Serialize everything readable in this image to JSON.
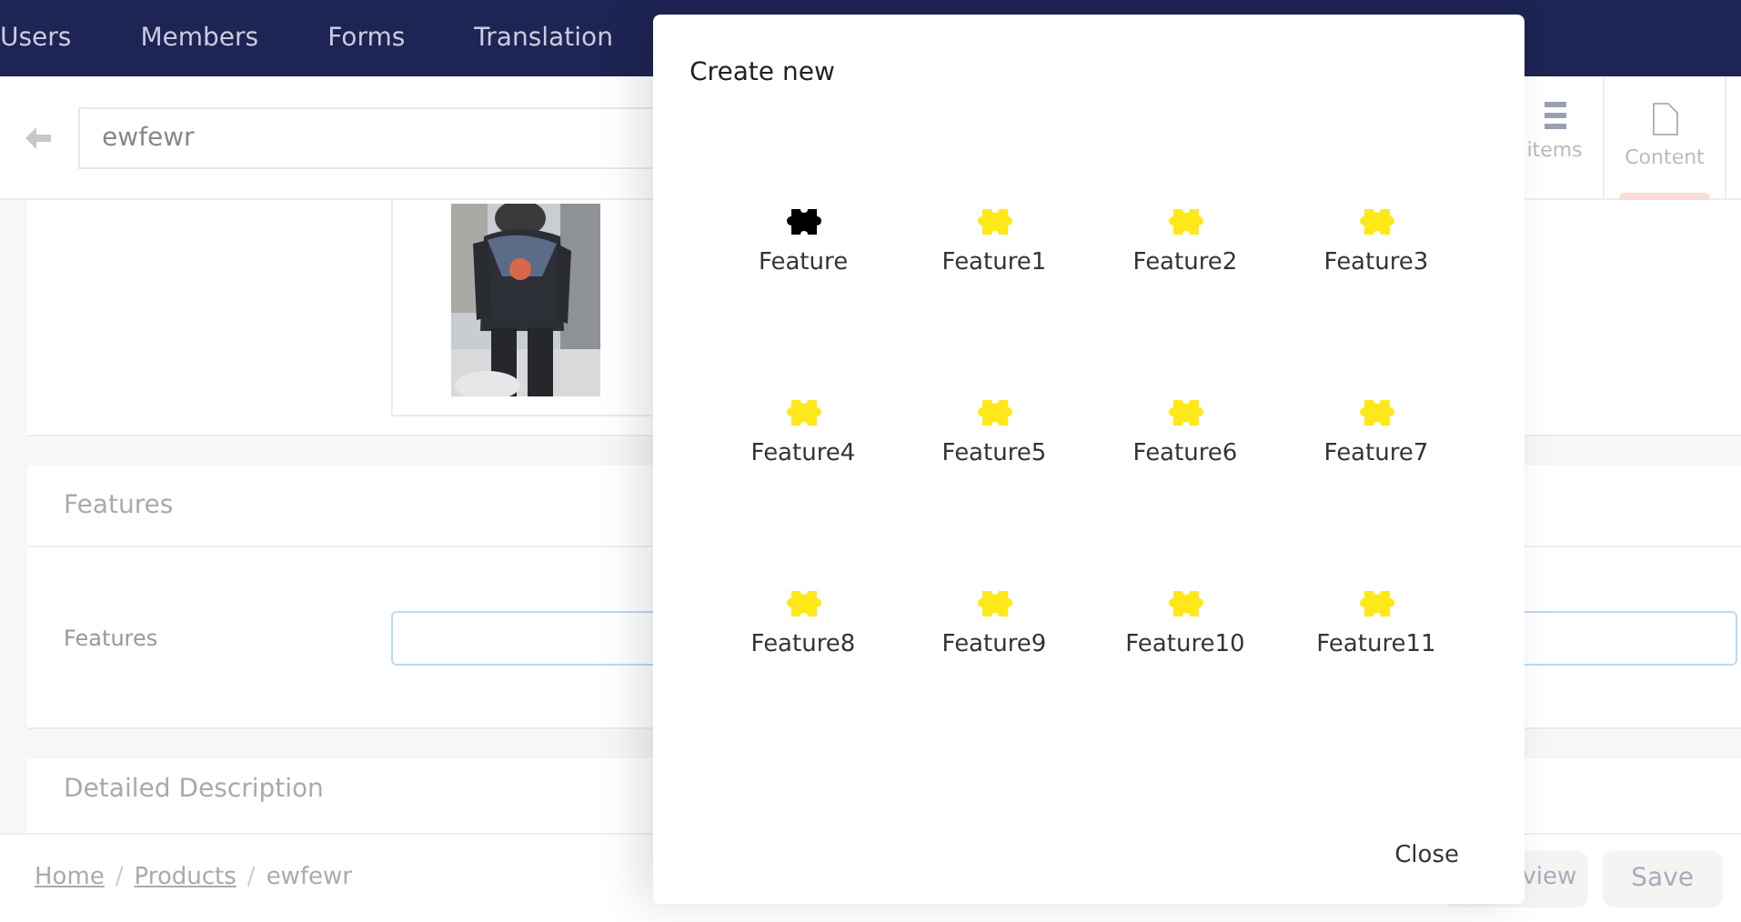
{
  "navbar": {
    "items": [
      "Users",
      "Members",
      "Forms",
      "Translation"
    ]
  },
  "header": {
    "title_value": "ewfewr",
    "tabs": [
      {
        "label": "items",
        "selected": false
      },
      {
        "label": "Content",
        "selected": true
      }
    ]
  },
  "sections": [
    {
      "kind": "picture"
    },
    {
      "kind": "field",
      "title": "Features",
      "field_label": "Features",
      "focused": true
    },
    {
      "kind": "heading",
      "title": "Detailed Description"
    }
  ],
  "breadcrumb": [
    {
      "kind": "link",
      "text": "Home"
    },
    {
      "kind": "separator",
      "text": "/"
    },
    {
      "kind": "link",
      "text": "Products"
    },
    {
      "kind": "separator",
      "text": "/"
    },
    {
      "kind": "current",
      "text": "ewfewr"
    }
  ],
  "footer_buttons": [
    "view",
    "Save"
  ],
  "dialog": {
    "title": "Create new",
    "items": [
      {
        "label": "Feature",
        "color": "#000000"
      },
      {
        "label": "Feature1",
        "color": "#ffe81a"
      },
      {
        "label": "Feature2",
        "color": "#ffe81a"
      },
      {
        "label": "Feature3",
        "color": "#ffe81a"
      },
      {
        "label": "Feature4",
        "color": "#ffe81a"
      },
      {
        "label": "Feature5",
        "color": "#ffe81a"
      },
      {
        "label": "Feature6",
        "color": "#ffe81a"
      },
      {
        "label": "Feature7",
        "color": "#ffe81a"
      },
      {
        "label": "Feature8",
        "color": "#ffe81a"
      },
      {
        "label": "Feature9",
        "color": "#ffe81a"
      },
      {
        "label": "Feature10",
        "color": "#ffe81a"
      },
      {
        "label": "Feature11",
        "color": "#ffe81a"
      }
    ],
    "close": "Close"
  }
}
